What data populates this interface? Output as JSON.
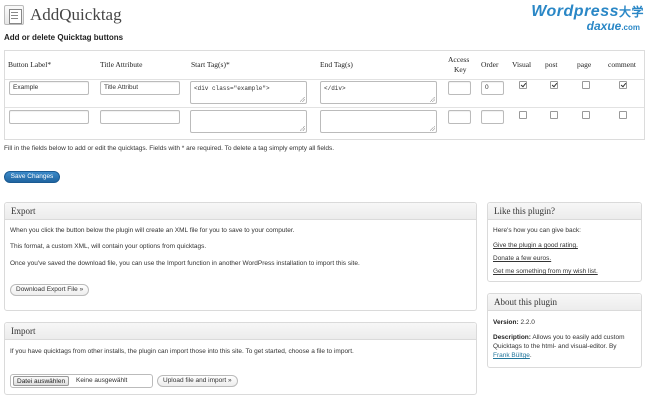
{
  "header": {
    "title": "AddQuicktag",
    "icon": "document-icon"
  },
  "logo": {
    "line1": "Wordpress",
    "line1_zh": "大学",
    "line2": "daxue",
    "line2_suffix": ".com",
    "color": "#2a87c6"
  },
  "subtitle": "Add or delete Quicktag buttons",
  "table": {
    "headers": {
      "button_label": "Button Label*",
      "title_attribute": "Title Attribute",
      "start_tags": "Start Tag(s)*",
      "end_tags": "End Tag(s)",
      "access_key_1": "Access",
      "access_key_2": "Key",
      "order": "Order",
      "visual": "Visual",
      "post": "post",
      "page": "page",
      "comment": "comment"
    },
    "rows": [
      {
        "button_label": "Example",
        "title_attribute": "Title Attribut",
        "start_tags": "<div class=\"example\">",
        "end_tags": "</div>",
        "access_key": "",
        "order": "0",
        "visual": true,
        "post": true,
        "page": false,
        "comment": true
      },
      {
        "button_label": "",
        "title_attribute": "",
        "start_tags": "",
        "end_tags": "",
        "access_key": "",
        "order": "",
        "visual": false,
        "post": false,
        "page": false,
        "comment": false
      }
    ]
  },
  "help_text": "Fill in the fields below to add or edit the quicktags. Fields with * are required. To delete a tag simply empty all fields.",
  "save_button": "Save Changes",
  "export": {
    "title": "Export",
    "p1": "When you click the button below the plugin will create an XML file for you to save to your computer.",
    "p2": "This format, a custom XML, will contain your options from quicktags.",
    "p3": "Once you've saved the download file, you can use the Import function in another WordPress installation to import this site.",
    "button": "Download Export File »"
  },
  "import": {
    "title": "Import",
    "p1": "If you have quicktags from other installs, the plugin can import those into this site. To get started, choose a file to import.",
    "file_button": "Datei auswählen",
    "file_status": "Keine ausgewählt",
    "upload_button": "Upload file and import »"
  },
  "like": {
    "title": "Like this plugin?",
    "intro": "Here's how you can give back:",
    "links": [
      "Give the plugin a good rating.",
      "Donate a few euros.",
      "Get me something from my wish list."
    ]
  },
  "about": {
    "title": "About this plugin",
    "version_label": "Version:",
    "version": "2.2.0",
    "desc_label": "Description:",
    "desc_line1": "Allows you to easily add custom",
    "desc_line2": "Quicktags to the html- and visual-editor. By",
    "author": "Frank Bültge",
    "author_suffix": "."
  }
}
